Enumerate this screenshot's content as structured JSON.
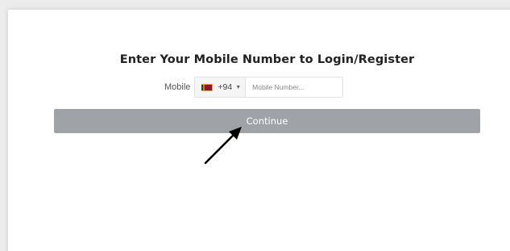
{
  "form": {
    "title": "Enter Your Mobile Number to Login/Register",
    "mobile_label": "Mobile",
    "country": {
      "dial_code": "+94",
      "flag_icon": "sri-lanka-flag-icon"
    },
    "phone_placeholder": "Mobile Number...",
    "phone_value": "",
    "continue_label": "Continue"
  },
  "colors": {
    "button_bg": "#9fa3a7",
    "button_text": "#ffffff",
    "annotation_arrow": "#000000"
  }
}
